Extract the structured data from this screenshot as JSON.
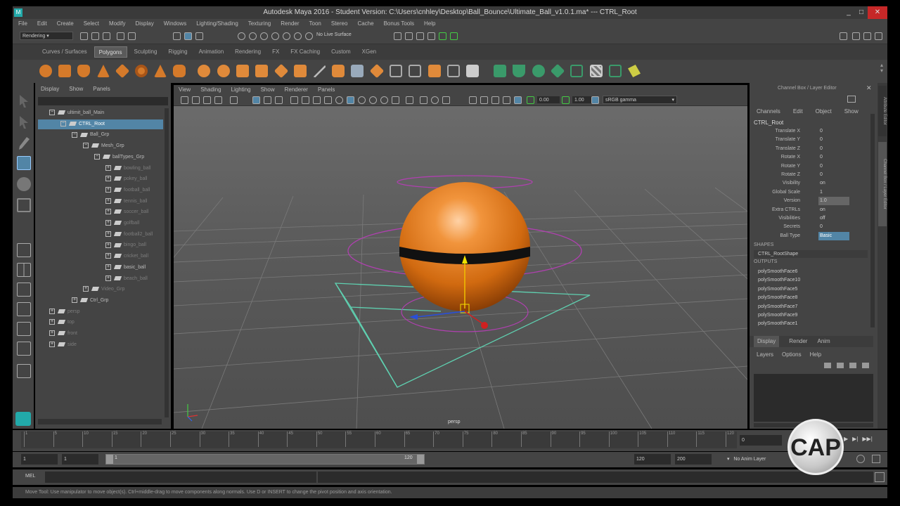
{
  "window": {
    "title": "Autodesk Maya 2016 - Student Version: C:\\Users\\cnhley\\Desktop\\Ball_Bounce\\Ultimate_Ball_v1.0.1.ma* --- CTRL_Root",
    "controls": [
      "_",
      "□",
      "✕"
    ]
  },
  "menu": [
    "File",
    "Edit",
    "Create",
    "Select",
    "Modify",
    "Display",
    "Windows",
    "Lighting/Shading",
    "Texturing",
    "Render",
    "Toon",
    "Stereo",
    "Cache",
    "Bonus Tools",
    "Help"
  ],
  "status": {
    "menu_set": "Rendering",
    "live_surface": "No Live Surface"
  },
  "shelf_tabs": [
    {
      "label": "Curves / Surfaces",
      "active": false
    },
    {
      "label": "Polygons",
      "active": true
    },
    {
      "label": "Sculpting",
      "active": false
    },
    {
      "label": "Rigging",
      "active": false
    },
    {
      "label": "Animation",
      "active": false
    },
    {
      "label": "Rendering",
      "active": false
    },
    {
      "label": "FX",
      "active": false
    },
    {
      "label": "FX Caching",
      "active": false
    },
    {
      "label": "Custom",
      "active": false
    },
    {
      "label": "XGen",
      "active": false
    }
  ],
  "outliner": {
    "menu": [
      "Display",
      "Show",
      "Panels"
    ],
    "rows": [
      {
        "label": "ultimit_ball_Main",
        "indent": 1,
        "exp": "−",
        "dim": false,
        "sel": false
      },
      {
        "label": "CTRL_Root",
        "indent": 2,
        "exp": "−",
        "dim": false,
        "sel": true
      },
      {
        "label": "Ball_Grp",
        "indent": 3,
        "exp": "−",
        "dim": false,
        "sel": false
      },
      {
        "label": "Mesh_Grp",
        "indent": 4,
        "exp": "−",
        "dim": false,
        "sel": false
      },
      {
        "label": "ballTypes_Grp",
        "indent": 5,
        "exp": "−",
        "dim": false,
        "sel": false
      },
      {
        "label": "bowling_ball",
        "indent": 6,
        "exp": "+",
        "dim": true,
        "sel": false
      },
      {
        "label": "pokey_ball",
        "indent": 6,
        "exp": "+",
        "dim": true,
        "sel": false
      },
      {
        "label": "football_ball",
        "indent": 6,
        "exp": "+",
        "dim": true,
        "sel": false
      },
      {
        "label": "tennis_ball",
        "indent": 6,
        "exp": "+",
        "dim": true,
        "sel": false
      },
      {
        "label": "soccer_ball",
        "indent": 6,
        "exp": "+",
        "dim": true,
        "sel": false
      },
      {
        "label": "golfball",
        "indent": 6,
        "exp": "+",
        "dim": true,
        "sel": false
      },
      {
        "label": "football2_ball",
        "indent": 6,
        "exp": "+",
        "dim": true,
        "sel": false
      },
      {
        "label": "bingo_ball",
        "indent": 6,
        "exp": "+",
        "dim": true,
        "sel": false
      },
      {
        "label": "cricket_ball",
        "indent": 6,
        "exp": "+",
        "dim": true,
        "sel": false
      },
      {
        "label": "basic_ball",
        "indent": 6,
        "exp": "+",
        "dim": false,
        "sel": false
      },
      {
        "label": "beach_ball",
        "indent": 6,
        "exp": "+",
        "dim": true,
        "sel": false
      },
      {
        "label": "Video_Grp",
        "indent": 4,
        "exp": "+",
        "dim": true,
        "sel": false
      },
      {
        "label": "Ctrl_Grp",
        "indent": 3,
        "exp": "+",
        "dim": false,
        "sel": false
      },
      {
        "label": "persp",
        "indent": 1,
        "exp": "+",
        "dim": true,
        "sel": false
      },
      {
        "label": "top",
        "indent": 1,
        "exp": "+",
        "dim": true,
        "sel": false
      },
      {
        "label": "front",
        "indent": 1,
        "exp": "+",
        "dim": true,
        "sel": false
      },
      {
        "label": "side",
        "indent": 1,
        "exp": "+",
        "dim": true,
        "sel": false
      }
    ]
  },
  "viewport": {
    "menu": [
      "View",
      "Shading",
      "Lighting",
      "Show",
      "Renderer",
      "Panels"
    ],
    "exposure": "0.00",
    "gamma": "1.00",
    "color_space": "sRGB gamma",
    "camera_label": "persp"
  },
  "channel_box": {
    "title": "Channel Box / Layer Editor",
    "menu": [
      "Channels",
      "Edit",
      "Object",
      "Show"
    ],
    "object": "CTRL_Root",
    "attributes": [
      {
        "name": "Translate X",
        "value": "0"
      },
      {
        "name": "Translate Y",
        "value": "0"
      },
      {
        "name": "Translate Z",
        "value": "0"
      },
      {
        "name": "Rotate X",
        "value": "0"
      },
      {
        "name": "Rotate Y",
        "value": "0"
      },
      {
        "name": "Rotate Z",
        "value": "0"
      },
      {
        "name": "Visibility",
        "value": "on"
      },
      {
        "name": "Global Scale",
        "value": "1"
      },
      {
        "name": "Version",
        "value": "1.0"
      },
      {
        "name": "Extra CTRLs",
        "value": "on"
      },
      {
        "name": "Visibilities",
        "value": "off"
      },
      {
        "name": "Secrets",
        "value": "0"
      },
      {
        "name": "Ball Type",
        "value": "Basic"
      }
    ],
    "shapes_header": "SHAPES",
    "shape": "CTRL_RootShape",
    "outputs_header": "OUTPUTS",
    "outputs": [
      "polySmoothFace6",
      "polySmoothFace10",
      "polySmoothFace5",
      "polySmoothFace8",
      "polySmoothFace7",
      "polySmoothFace9",
      "polySmoothFace1"
    ]
  },
  "layer_editor": {
    "tabs": [
      "Display",
      "Render",
      "Anim"
    ],
    "menu": [
      "Layers",
      "Options",
      "Help"
    ]
  },
  "side_tabs": [
    "Attribute Editor",
    "Channel Box / Layer Editor"
  ],
  "timeline": {
    "ticks": [
      "1",
      "5",
      "10",
      "15",
      "20",
      "25",
      "30",
      "35",
      "40",
      "45",
      "50",
      "55",
      "60",
      "65",
      "70",
      "75",
      "80",
      "85",
      "90",
      "95",
      "100",
      "105",
      "110",
      "115",
      "120"
    ],
    "current_frame": "0"
  },
  "range": {
    "start": "1",
    "playback_start": "1",
    "slider_min": "1",
    "slider_max": "120",
    "playback_end": "120",
    "end": "200",
    "anim_layer": "No Anim Layer"
  },
  "cmd": {
    "label": "MEL"
  },
  "help_text": "Move Tool: Use manipulator to move object(s). Ctrl+middle-drag to move components along normals. Use D or INSERT to change the pivot position and axis orientation.",
  "watermark": "CAP",
  "colors": {
    "accent_selection": "#5285a6",
    "ball_orange": "#e07a1a",
    "control_curve": "#b040b0",
    "camera_frustum": "#5fd0b0"
  }
}
